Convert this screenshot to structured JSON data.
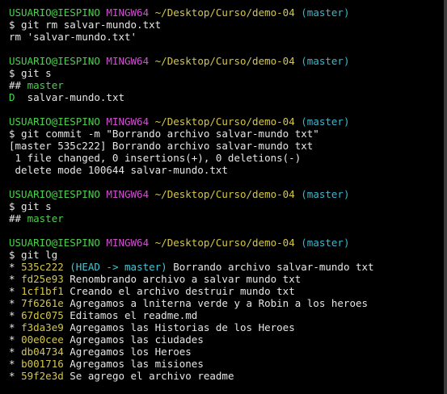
{
  "colors": {
    "background": "#000000",
    "user": "#4dd04d",
    "shell": "#d24fd2",
    "path": "#d4c64a",
    "branch": "#39b8d0",
    "text": "#e6e6e6",
    "deleted": "#e04848"
  },
  "prompt": {
    "user": "USUARIO@IESPINO",
    "shell": "MINGW64",
    "path": "~/Desktop/Curso/demo-04",
    "branch": "(master)"
  },
  "blocks": [
    {
      "command": "$ git rm salvar-mundo.txt",
      "output": [
        "rm 'salvar-mundo.txt'"
      ]
    },
    {
      "command": "$ git s",
      "status_branch_prefix": "##",
      "status_branch": "master",
      "status_flag": "D",
      "status_file": "salvar-mundo.txt"
    },
    {
      "command": "$ git commit -m \"Borrando archivo salvar-mundo txt\"",
      "output": [
        "[master 535c222] Borrando archivo salvar-mundo txt",
        " 1 file changed, 0 insertions(+), 0 deletions(-)",
        " delete mode 100644 salvar-mundo.txt"
      ]
    },
    {
      "command": "$ git s",
      "status_branch_prefix": "##",
      "status_branch": "master"
    },
    {
      "command": "$ git lg",
      "head_ref": "(HEAD -> master)",
      "log": [
        {
          "bullet": "*",
          "hash": "535c222",
          "message": "Borrando archivo salvar-mundo txt"
        },
        {
          "bullet": "*",
          "hash": "fd25e93",
          "message": "Renombrando archivo a salvar mundo txt"
        },
        {
          "bullet": "*",
          "hash": "1cf1bf1",
          "message": "Creando el archivo destruir mundo txt"
        },
        {
          "bullet": "*",
          "hash": "7f6261e",
          "message": "Agregamos a lniterna verde y a Robin a los heroes"
        },
        {
          "bullet": "*",
          "hash": "67dc075",
          "message": "Editamos el readme.md"
        },
        {
          "bullet": "*",
          "hash": "f3da3e9",
          "message": "Agregamos las Historias de los Heroes"
        },
        {
          "bullet": "*",
          "hash": "00e0cee",
          "message": "Agregamos las ciudades"
        },
        {
          "bullet": "*",
          "hash": "db04734",
          "message": "Agregamos los Heroes"
        },
        {
          "bullet": "*",
          "hash": "b001716",
          "message": "Agregamos las misiones"
        },
        {
          "bullet": "*",
          "hash": "59f2e3d",
          "message": "Se agrego el archivo readme"
        }
      ]
    }
  ]
}
